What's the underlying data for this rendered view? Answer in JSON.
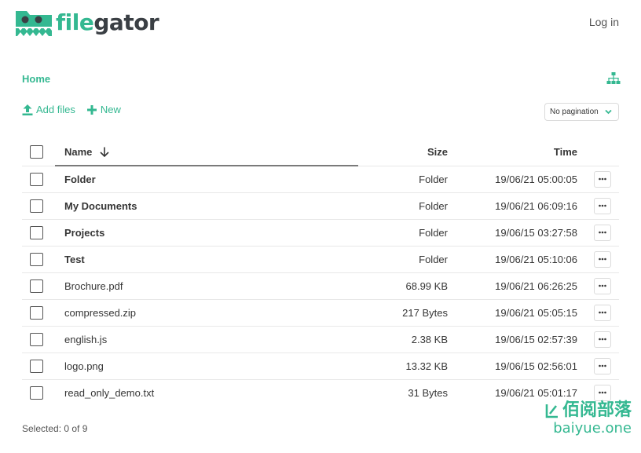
{
  "header": {
    "logo": {
      "part1": "file",
      "part2": "gator"
    },
    "login_label": "Log in"
  },
  "breadcrumb": {
    "home": "Home"
  },
  "toolbar": {
    "add_files_label": "Add files",
    "new_label": "New",
    "pagination_value": "No pagination"
  },
  "table": {
    "columns": {
      "name": "Name",
      "size": "Size",
      "time": "Time"
    },
    "rows": [
      {
        "name": "Folder",
        "size": "Folder",
        "time": "19/06/21 05:00:05",
        "is_dir": true
      },
      {
        "name": "My Documents",
        "size": "Folder",
        "time": "19/06/21 06:09:16",
        "is_dir": true
      },
      {
        "name": "Projects",
        "size": "Folder",
        "time": "19/06/15 03:27:58",
        "is_dir": true
      },
      {
        "name": "Test",
        "size": "Folder",
        "time": "19/06/21 05:10:06",
        "is_dir": true
      },
      {
        "name": "Brochure.pdf",
        "size": "68.99 KB",
        "time": "19/06/21 06:26:25",
        "is_dir": false
      },
      {
        "name": "compressed.zip",
        "size": "217 Bytes",
        "time": "19/06/21 05:05:15",
        "is_dir": false
      },
      {
        "name": "english.js",
        "size": "2.38 KB",
        "time": "19/06/15 02:57:39",
        "is_dir": false
      },
      {
        "name": "logo.png",
        "size": "13.32 KB",
        "time": "19/06/15 02:56:01",
        "is_dir": false
      },
      {
        "name": "read_only_demo.txt",
        "size": "31 Bytes",
        "time": "19/06/21 05:01:17",
        "is_dir": false
      }
    ]
  },
  "footer": {
    "selection_status": "Selected: 0 of 9"
  },
  "watermark": {
    "cn": "佰阅部落",
    "en": "baiyue.one"
  },
  "colors": {
    "accent": "#34b891",
    "dark": "#3a3f44"
  },
  "icons": {
    "add_files": "upload-icon",
    "new": "plus-icon",
    "tree": "sitemap-icon",
    "sort": "arrow-down-icon",
    "row_action": "ellipsis-icon"
  }
}
